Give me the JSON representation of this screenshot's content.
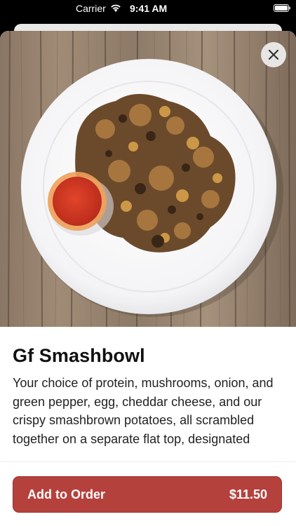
{
  "status_bar": {
    "carrier": "Carrier",
    "time": "9:41 AM"
  },
  "item": {
    "name": "Gf Smashbowl",
    "description": "Your choice of protein, mushrooms, onion, and green pepper, egg, cheddar cheese, and our crispy smashbrown potatoes, all scrambled together on a separate flat top, designated gluten free. Add a side of"
  },
  "order_button": {
    "label": "Add to Order",
    "price": "$11.50"
  },
  "colors": {
    "accent": "#b5413d"
  },
  "icons": {
    "close": "close-icon",
    "wifi": "wifi-icon",
    "battery": "battery-icon"
  }
}
